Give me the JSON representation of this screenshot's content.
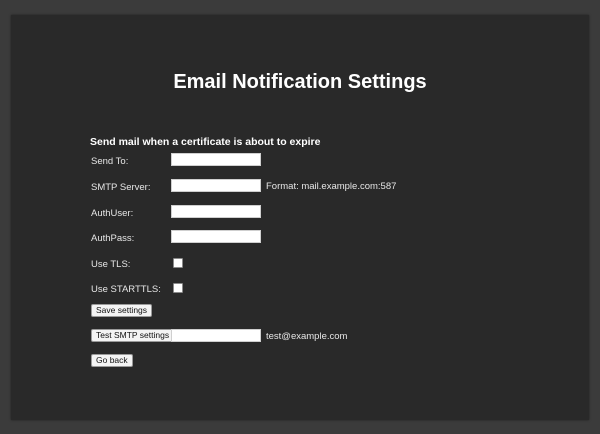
{
  "page": {
    "title": "Email Notification Settings",
    "section_heading": "Send mail when a certificate is about to expire"
  },
  "form": {
    "send_to": {
      "label": "Send To:",
      "value": ""
    },
    "smtp_server": {
      "label": "SMTP Server:",
      "value": "",
      "hint": "Format: mail.example.com:587"
    },
    "auth_user": {
      "label": "AuthUser:",
      "value": ""
    },
    "auth_pass": {
      "label": "AuthPass:",
      "value": ""
    },
    "use_tls": {
      "label": "Use TLS:",
      "checked": false
    },
    "use_starttls": {
      "label": "Use STARTTLS:",
      "checked": false
    },
    "save_button": "Save settings",
    "test_button": "Test SMTP settings",
    "test_address": {
      "value": "",
      "hint": "test@example.com"
    },
    "back_button": "Go back"
  },
  "colors": {
    "page_background": "#3b3b3b",
    "panel_background": "#292929",
    "text": "#ffffff"
  }
}
